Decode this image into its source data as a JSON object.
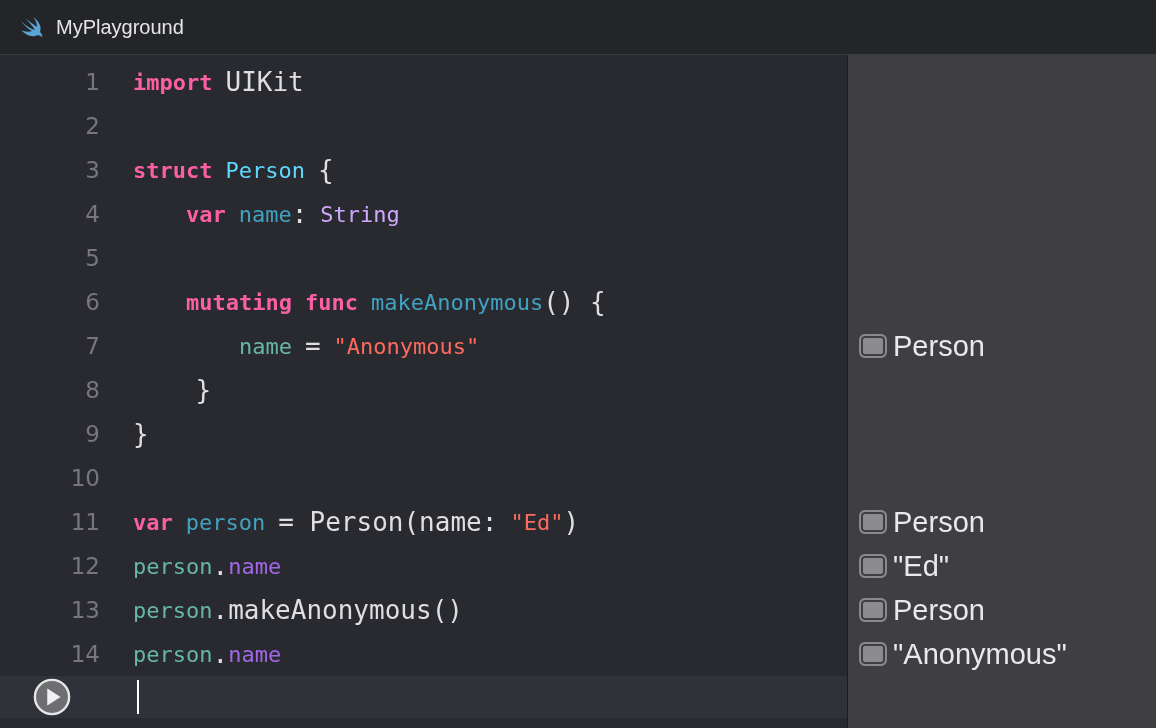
{
  "window": {
    "title": "MyPlayground"
  },
  "lines": [
    {
      "number": "1",
      "tokens": [
        {
          "text": "import",
          "kind": "keyword"
        },
        {
          "text": "UIKit",
          "kind": "plain"
        }
      ]
    },
    {
      "number": "2"
    },
    {
      "number": "3",
      "tokens": [
        {
          "text": "struct",
          "kind": "keyword"
        },
        {
          "text": "Person",
          "kind": "type-decl"
        },
        {
          "text": "{",
          "kind": "plain"
        }
      ]
    },
    {
      "number": "4",
      "tokens": [
        {
          "text": "    var",
          "kind": "keyword"
        },
        {
          "text": "name",
          "kind": "decl"
        },
        {
          "text": ":",
          "kind": "plain-tight"
        },
        {
          "text": "String",
          "kind": "type"
        }
      ]
    },
    {
      "number": "5"
    },
    {
      "number": "6",
      "tokens": [
        {
          "text": "    mutating",
          "kind": "keyword"
        },
        {
          "text": "func",
          "kind": "keyword"
        },
        {
          "text": "makeAnonymous",
          "kind": "decl"
        },
        {
          "text": "() {",
          "kind": "plain-tight"
        }
      ]
    },
    {
      "number": "7",
      "tokens": [
        {
          "text": "        name",
          "kind": "variable"
        },
        {
          "text": "=",
          "kind": "plain"
        },
        {
          "text": "\"Anonymous\"",
          "kind": "string"
        }
      ],
      "result": "Person"
    },
    {
      "number": "8",
      "tokens": [
        {
          "text": "    }",
          "kind": "plain"
        }
      ]
    },
    {
      "number": "9",
      "tokens": [
        {
          "text": "}",
          "kind": "plain"
        }
      ]
    },
    {
      "number": "10"
    },
    {
      "number": "11",
      "tokens": [
        {
          "text": "var",
          "kind": "keyword"
        },
        {
          "text": "person",
          "kind": "decl"
        },
        {
          "text": "= Person(name:",
          "kind": "plain"
        },
        {
          "text": "\"Ed\"",
          "kind": "string"
        },
        {
          "text": ")",
          "kind": "plain-tight"
        }
      ],
      "result": "Person"
    },
    {
      "number": "12",
      "tokens": [
        {
          "text": "person",
          "kind": "variable"
        },
        {
          "text": ".",
          "kind": "plain-tight"
        },
        {
          "text": "name",
          "kind": "member-tight"
        }
      ],
      "result": "\"Ed\""
    },
    {
      "number": "13",
      "tokens": [
        {
          "text": "person",
          "kind": "variable"
        },
        {
          "text": ".makeAnonymous()",
          "kind": "plain-tight"
        }
      ],
      "result": "Person"
    },
    {
      "number": "14",
      "tokens": [
        {
          "text": "person",
          "kind": "variable"
        },
        {
          "text": ".",
          "kind": "plain-tight"
        },
        {
          "text": "name",
          "kind": "member-tight"
        }
      ],
      "result": "\"Anonymous\""
    }
  ]
}
